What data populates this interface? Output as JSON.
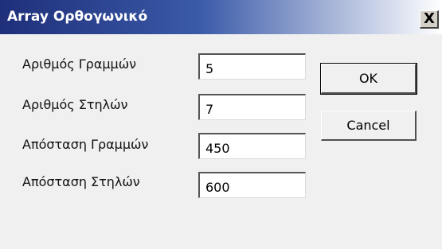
{
  "window": {
    "title": "Array Ορθογωνικό",
    "close_glyph": "X"
  },
  "form": {
    "rows_label": "Αριθμός Γραμμών",
    "rows_value": "5",
    "cols_label": "Αριθμός Στηλών",
    "cols_value": "7",
    "row_dist_label": "Απόσταση Γραμμών",
    "row_dist_value": "450",
    "col_dist_label": "Απόσταση Στηλών",
    "col_dist_value": "600"
  },
  "buttons": {
    "ok_label": "OK",
    "cancel_label": "Cancel"
  },
  "colors": {
    "titlebar_start": "#1f2f7a",
    "titlebar_end": "#ffffff",
    "dialog_bg": "#f0f0f0"
  }
}
